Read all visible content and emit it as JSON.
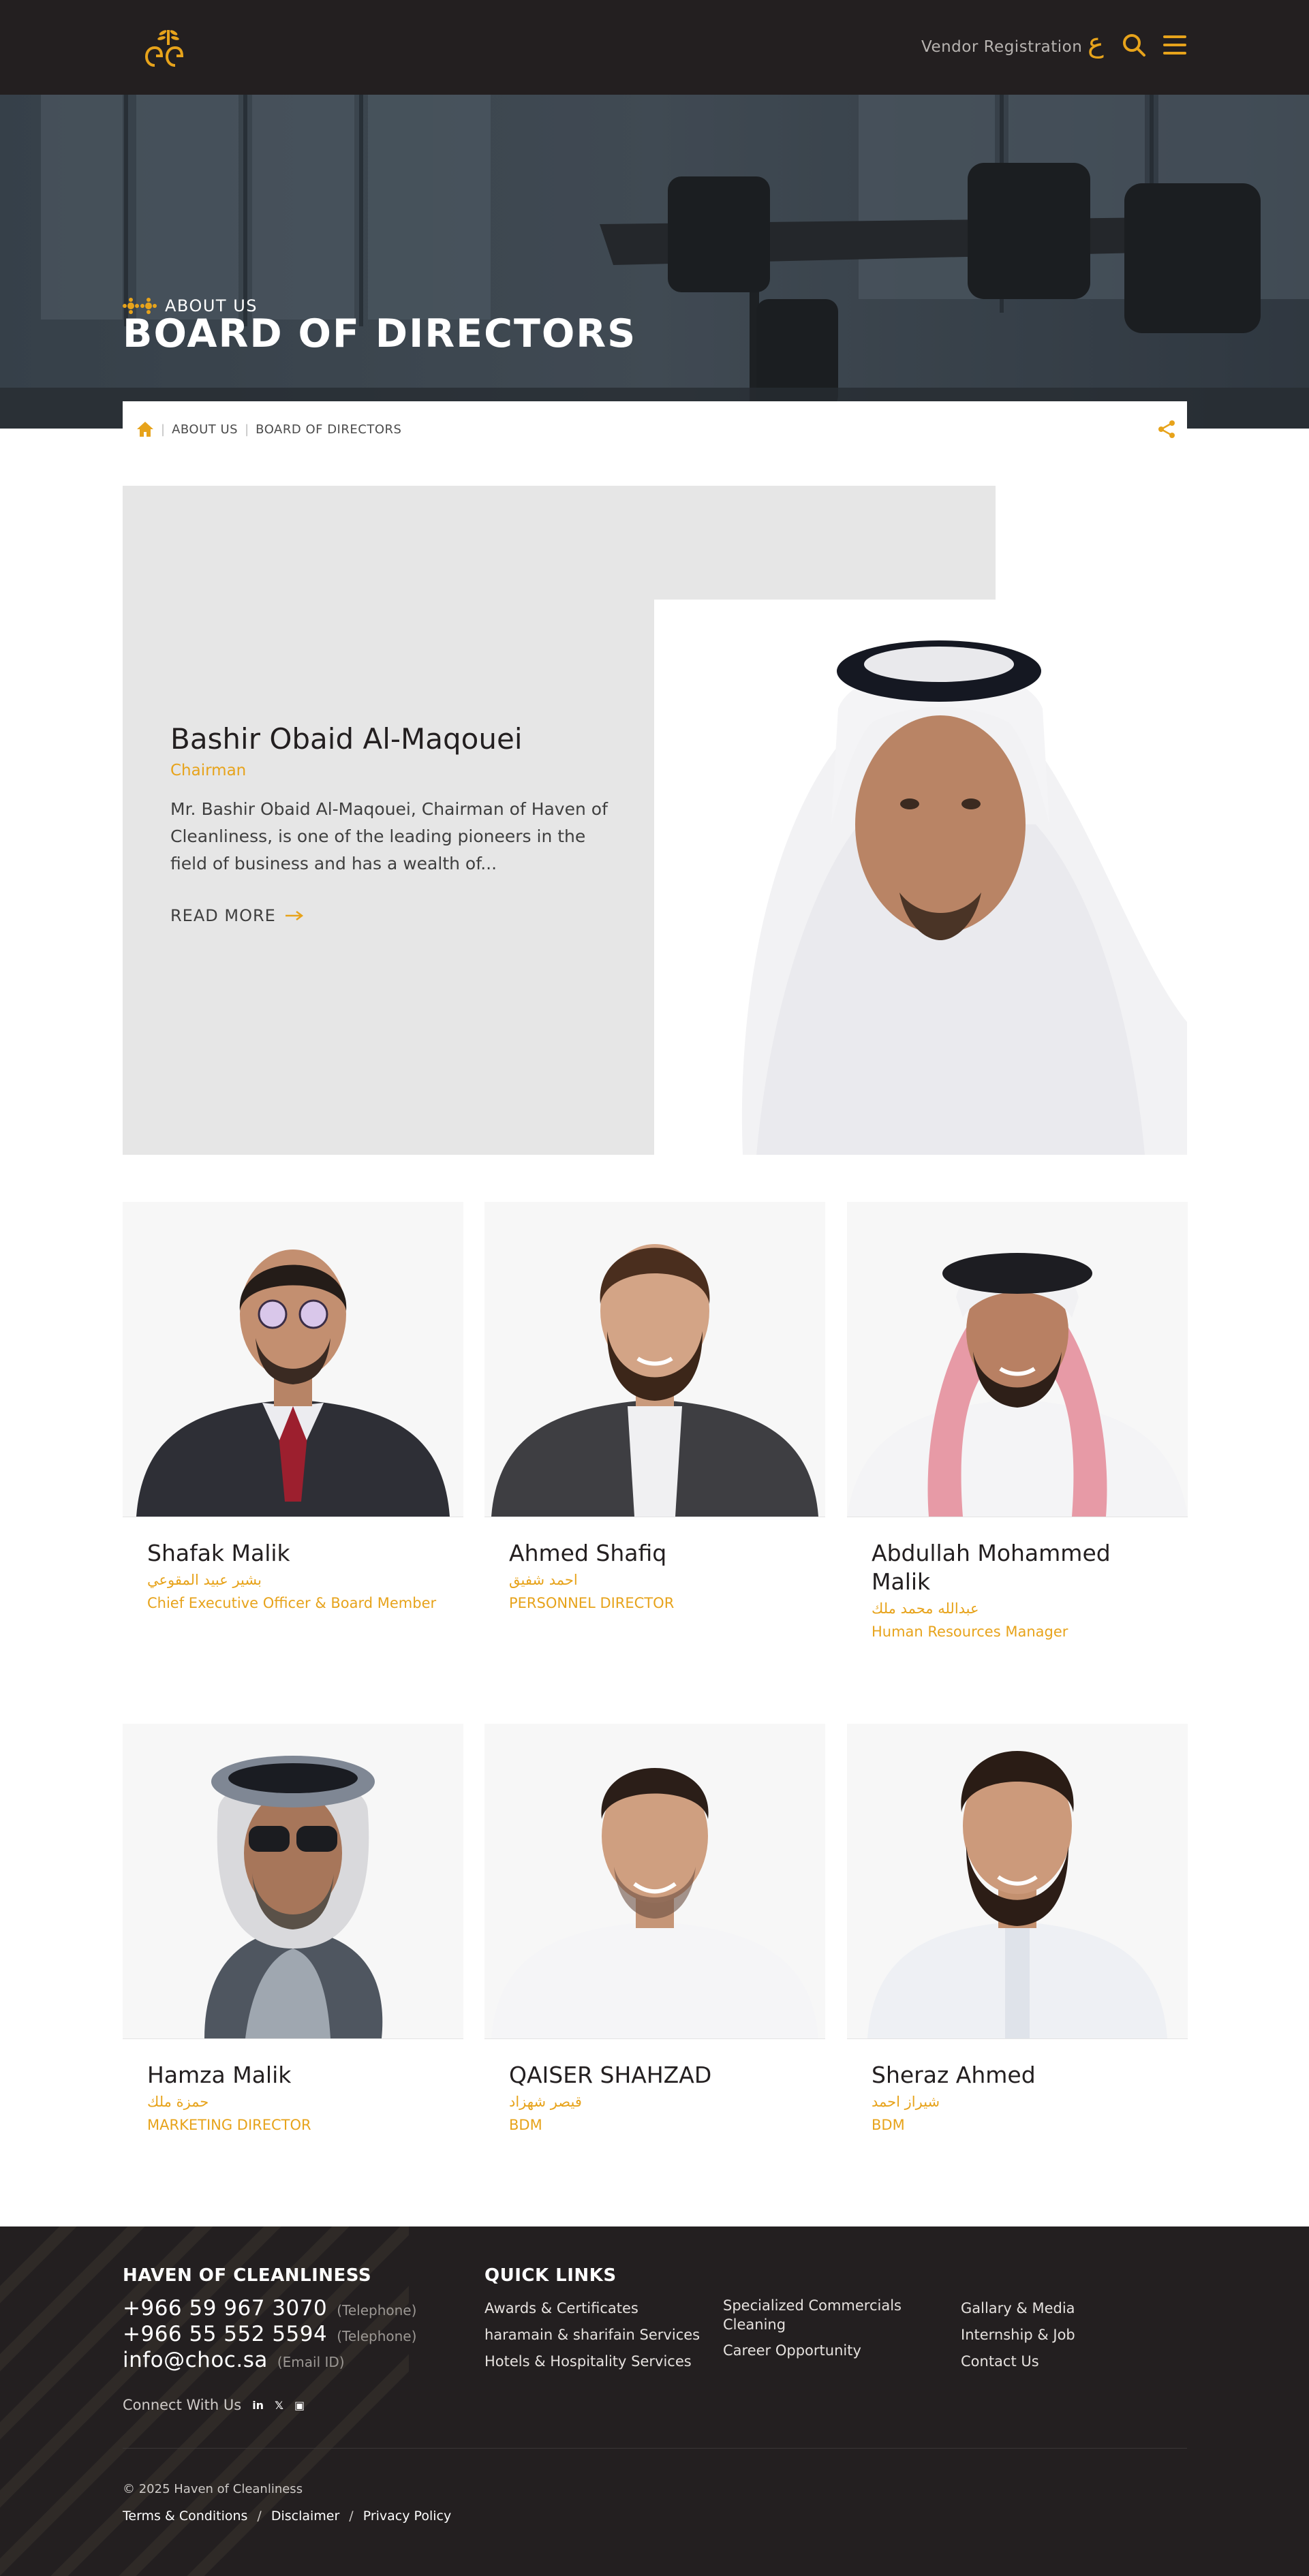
{
  "header": {
    "vendor_label": "Vendor Registration",
    "lang_toggle": "ع",
    "accent_color": "#e7a31b",
    "background_color": "#231f20"
  },
  "hero": {
    "kicker": "ABOUT US",
    "title": "BOARD OF DIRECTORS"
  },
  "breadcrumb": {
    "home_icon": "home-icon",
    "items": [
      "ABOUT US",
      "BOARD OF DIRECTORS"
    ],
    "share_icon": "share-icon"
  },
  "featured": {
    "name": "Bashir Obaid Al-Maqouei",
    "role": "Chairman",
    "bio": "Mr. Bashir Obaid Al-Maqouei, Chairman of Haven of Cleanliness, is one of the leading pioneers in the field of business and has a wealth of...",
    "read_more": "READ MORE"
  },
  "directors": [
    {
      "name": "Shafak Malik",
      "arabic": "بشير عبيد المقوعي",
      "role": "Chief Executive Officer & Board Member"
    },
    {
      "name": "Ahmed Shafiq",
      "arabic": "احمد شفيق",
      "role": "PERSONNEL DIRECTOR"
    },
    {
      "name": "Abdullah Mohammed Malik",
      "arabic": "عبدالله محمد ملك",
      "role": "Human Resources Manager"
    },
    {
      "name": "Hamza Malik",
      "arabic": "حمزة ملك",
      "role": "MARKETING DIRECTOR"
    },
    {
      "name": "QAISER SHAHZAD",
      "arabic": "قيصر شهزاد",
      "role": "BDM"
    },
    {
      "name": "Sheraz Ahmed",
      "arabic": "شيراز احمد",
      "role": "BDM"
    }
  ],
  "footer": {
    "company_heading": "HAVEN OF CLEANLINESS",
    "phone1": "+966 59 967 3070",
    "phone1_label": "(Telephone)",
    "phone2": "+966 55 552 5594",
    "phone2_label": "(Telephone)",
    "email": "info@choc.sa",
    "email_label": "(Email ID)",
    "connect_label": "Connect With Us",
    "social": [
      "in",
      "𝕏",
      "▣"
    ],
    "quick_links_heading": "QUICK LINKS",
    "quick_links": [
      "Awards & Certificates",
      "haramain & sharifain Services",
      "Hotels & Hospitality Services",
      "Specialized Commercials Cleaning",
      "Career Opportunity",
      "Gallary & Media",
      "Internship & Job",
      "Contact Us"
    ],
    "copyright": "© 2025 Haven of Cleanliness",
    "legal": [
      "Terms & Conditions",
      "Disclaimer",
      "Privacy Policy"
    ]
  }
}
